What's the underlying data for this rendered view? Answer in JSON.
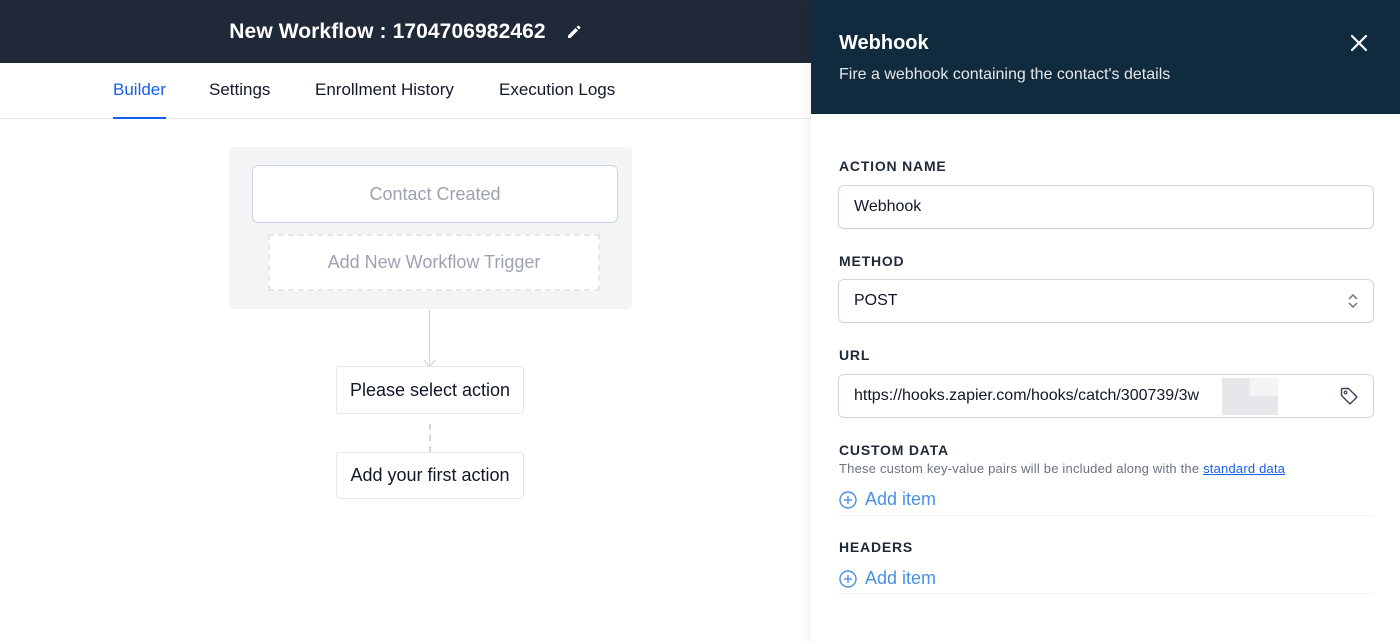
{
  "header": {
    "workflow_title": "New Workflow : 1704706982462",
    "edit_icon": "pencil-icon"
  },
  "tabs": [
    {
      "label": "Builder",
      "active": true
    },
    {
      "label": "Settings",
      "active": false
    },
    {
      "label": "Enrollment History",
      "active": false
    },
    {
      "label": "Execution Logs",
      "active": false
    }
  ],
  "builder": {
    "trigger_label": "Contact Created",
    "add_trigger_label": "Add New Workflow Trigger",
    "select_action_label": "Please select action",
    "first_action_label": "Add your first action"
  },
  "panel": {
    "title": "Webhook",
    "subtitle": "Fire a webhook containing the contact's details",
    "close_icon": "close-icon",
    "action_name": {
      "label": "ACTION NAME",
      "value": "Webhook"
    },
    "method": {
      "label": "METHOD",
      "value": "POST"
    },
    "url": {
      "label": "URL",
      "value": "https://hooks.zapier.com/hooks/catch/300739/3w",
      "icon": "tag-icon"
    },
    "custom_data": {
      "label": "CUSTOM DATA",
      "help_text": "These custom key-value pairs will be included along with the ",
      "help_link": "standard data",
      "add_label": "Add item"
    },
    "headers": {
      "label": "HEADERS",
      "add_label": "Add item"
    }
  },
  "colors": {
    "topbar": "#1f2937",
    "panel_header": "#0f2b3d",
    "active_tab": "#155eef",
    "add_item": "#4a90e2"
  }
}
